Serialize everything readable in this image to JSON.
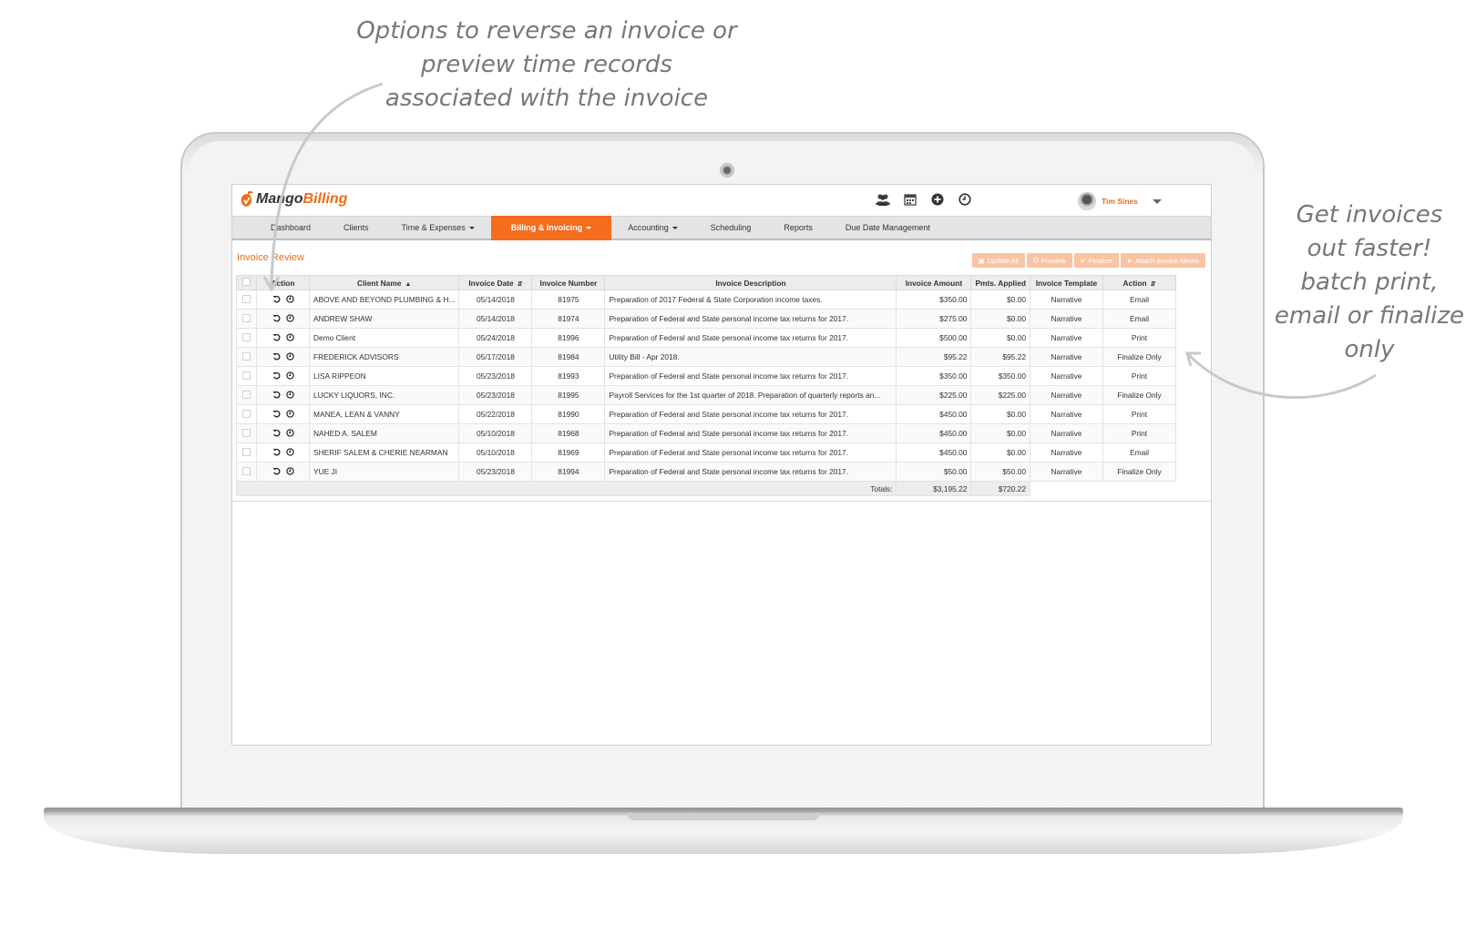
{
  "annotations": {
    "left_lines": [
      "Options to reverse an invoice or",
      "preview time records",
      "associated with the invoice"
    ],
    "right_lines": [
      "Get invoices",
      "out faster!",
      "batch print,",
      "email or finalize",
      "only"
    ]
  },
  "app": {
    "logo_mango": "Mango",
    "logo_billing": "Billing",
    "header_icons": [
      "users-icon",
      "calendar-icon",
      "plus-circle-icon",
      "clock-icon"
    ],
    "user_name": "Tim Sines"
  },
  "nav": {
    "items": [
      {
        "label": "Dashboard",
        "dropdown": false,
        "active": false
      },
      {
        "label": "Clients",
        "dropdown": false,
        "active": false
      },
      {
        "label": "Time & Expenses",
        "dropdown": true,
        "active": false
      },
      {
        "label": "Billing & Invoicing",
        "dropdown": true,
        "active": true
      },
      {
        "label": "Accounting",
        "dropdown": true,
        "active": false
      },
      {
        "label": "Scheduling",
        "dropdown": false,
        "active": false
      },
      {
        "label": "Reports",
        "dropdown": false,
        "active": false
      },
      {
        "label": "Due Date Management",
        "dropdown": false,
        "active": false
      }
    ]
  },
  "page": {
    "title": "Invoice Review",
    "buttons": {
      "update_all": "Update All",
      "preview": "Preview",
      "finalize": "Finalize",
      "attach_memo": "Attach Invoice Memo"
    }
  },
  "table": {
    "headers": {
      "action": "Action",
      "client_name": "Client Name",
      "invoice_date": "Invoice Date",
      "invoice_number": "Invoice Number",
      "invoice_description": "Invoice Description",
      "invoice_amount": "Invoice Amount",
      "pmts_applied": "Pmts. Applied",
      "invoice_template": "Invoice Template",
      "action2": "Action"
    },
    "rows": [
      {
        "client": "ABOVE AND BEYOND PLUMBING & H...",
        "date": "05/14/2018",
        "number": "81975",
        "description": "Preparation of 2017 Federal & State Corporation income taxes.",
        "amount": "$350.00",
        "applied": "$0.00",
        "template": "Narrative",
        "action": "Email"
      },
      {
        "client": "ANDREW SHAW",
        "date": "05/14/2018",
        "number": "81974",
        "description": "Preparation of Federal and State personal income tax returns for 2017.",
        "amount": "$275.00",
        "applied": "$0.00",
        "template": "Narrative",
        "action": "Email"
      },
      {
        "client": "Demo Client",
        "date": "05/24/2018",
        "number": "81996",
        "description": "Preparation of Federal and State personal income tax returns for 2017.",
        "amount": "$500.00",
        "applied": "$0.00",
        "template": "Narrative",
        "action": "Print"
      },
      {
        "client": "FREDERICK ADVISORS",
        "date": "05/17/2018",
        "number": "81984",
        "description": "Utility Bill - Apr 2018.",
        "amount": "$95.22",
        "applied": "$95.22",
        "template": "Narrative",
        "action": "Finalize Only"
      },
      {
        "client": "LISA RIPPEON",
        "date": "05/23/2018",
        "number": "81993",
        "description": "Preparation of Federal and State personal income tax returns for 2017.",
        "amount": "$350.00",
        "applied": "$350.00",
        "template": "Narrative",
        "action": "Print"
      },
      {
        "client": "LUCKY LIQUORS, INC.",
        "date": "05/23/2018",
        "number": "81995",
        "description": "Payroll Services for the 1st quarter of 2018. Preparation of quarterly reports an...",
        "amount": "$225.00",
        "applied": "$225.00",
        "template": "Narrative",
        "action": "Finalize Only"
      },
      {
        "client": "MANEA, LEAN & VANNY",
        "date": "05/22/2018",
        "number": "81990",
        "description": "Preparation of Federal and State personal income tax returns for 2017.",
        "amount": "$450.00",
        "applied": "$0.00",
        "template": "Narrative",
        "action": "Print"
      },
      {
        "client": "NAHED A. SALEM",
        "date": "05/10/2018",
        "number": "81968",
        "description": "Preparation of Federal and State personal income tax returns for 2017.",
        "amount": "$450.00",
        "applied": "$0.00",
        "template": "Narrative",
        "action": "Print"
      },
      {
        "client": "SHERIF SALEM & CHERIE NEARMAN",
        "date": "05/10/2018",
        "number": "81969",
        "description": "Preparation of Federal and State personal income tax returns for 2017.",
        "amount": "$450.00",
        "applied": "$0.00",
        "template": "Narrative",
        "action": "Email"
      },
      {
        "client": "YUE JI",
        "date": "05/23/2018",
        "number": "81994",
        "description": "Preparation of Federal and State personal income tax returns for 2017.",
        "amount": "$50.00",
        "applied": "$50.00",
        "template": "Narrative",
        "action": "Finalize Only"
      }
    ],
    "totals": {
      "label": "Totals:",
      "amount": "$3,195.22",
      "applied": "$720.22"
    }
  },
  "colors": {
    "brand_orange": "#f06a17",
    "nav_active": "#f46c1e",
    "button_disabled": "#f9c4a3"
  }
}
